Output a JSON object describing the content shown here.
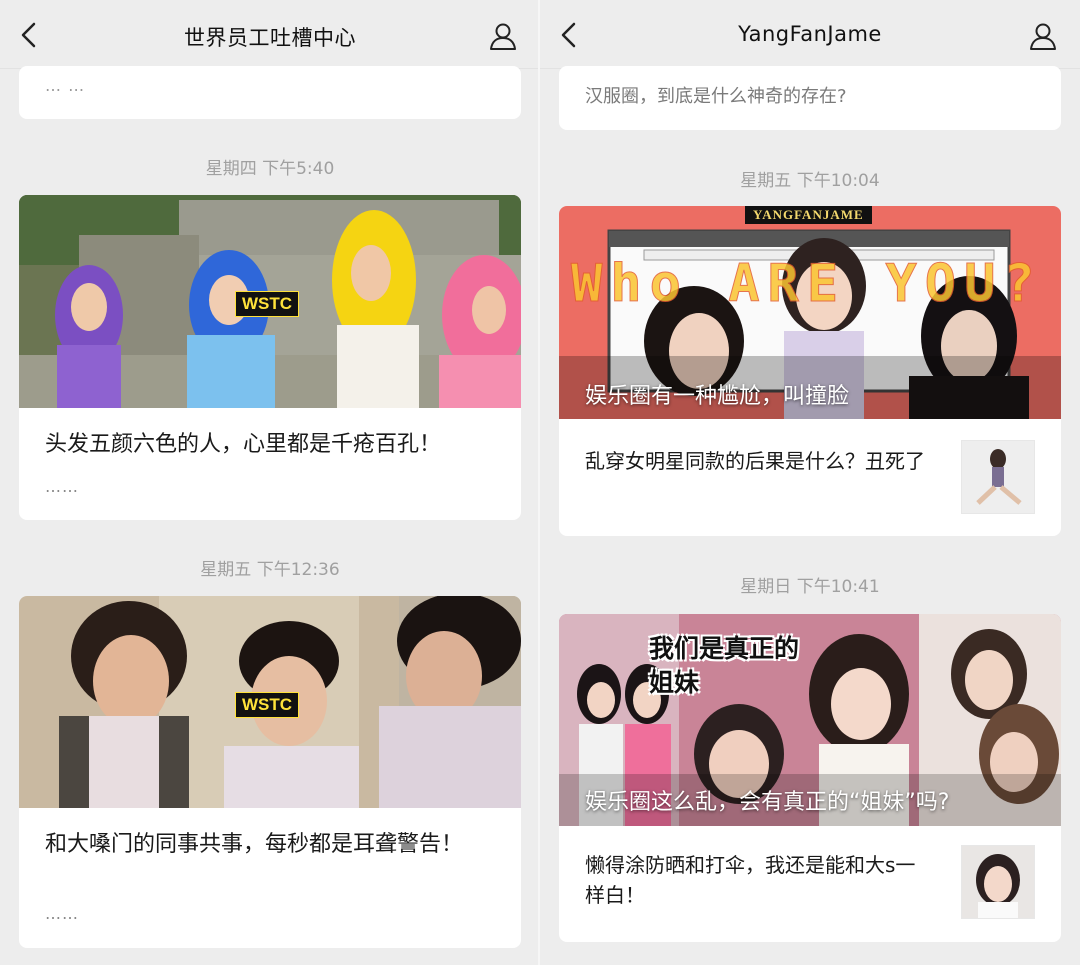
{
  "left": {
    "title": "世界员工吐槽中心",
    "prev_snippet": "… …",
    "posts": [
      {
        "timestamp": "星期四 下午5:40",
        "badge": "WSTC",
        "title": "头发五颜六色的人，心里都是千疮百孔！",
        "more": "……"
      },
      {
        "timestamp": "星期五 下午12:36",
        "badge": "WSTC",
        "title": "和大嗓门的同事共事，每秒都是耳聋警告！",
        "more": "……"
      }
    ]
  },
  "right": {
    "title": "YangFanJame",
    "prev_snippet": "汉服圈，到底是什么神奇的存在?",
    "posts": [
      {
        "timestamp": "星期五 下午10:04",
        "cover_banner": "YANGFANJAME",
        "cover_art_text": "Who ARE YOU?",
        "cover_caption": "娱乐圈有一种尴尬，叫撞脸",
        "sub_title": "乱穿女明星同款的后果是什么？丑死了"
      },
      {
        "timestamp": "星期日 下午10:41",
        "cover_art_text": "我们是真正的姐妹",
        "cover_caption": "娱乐圈这么乱，会有真正的“姐妹”吗?",
        "sub_title": "懒得涂防晒和打伞，我还是能和大s一样白！"
      }
    ]
  },
  "colors": {
    "background": "#ededed",
    "card": "#ffffff",
    "timestamp": "#a0a0a0",
    "badge_text": "#ffe23a"
  },
  "icons": [
    "back-icon",
    "profile-icon"
  ]
}
